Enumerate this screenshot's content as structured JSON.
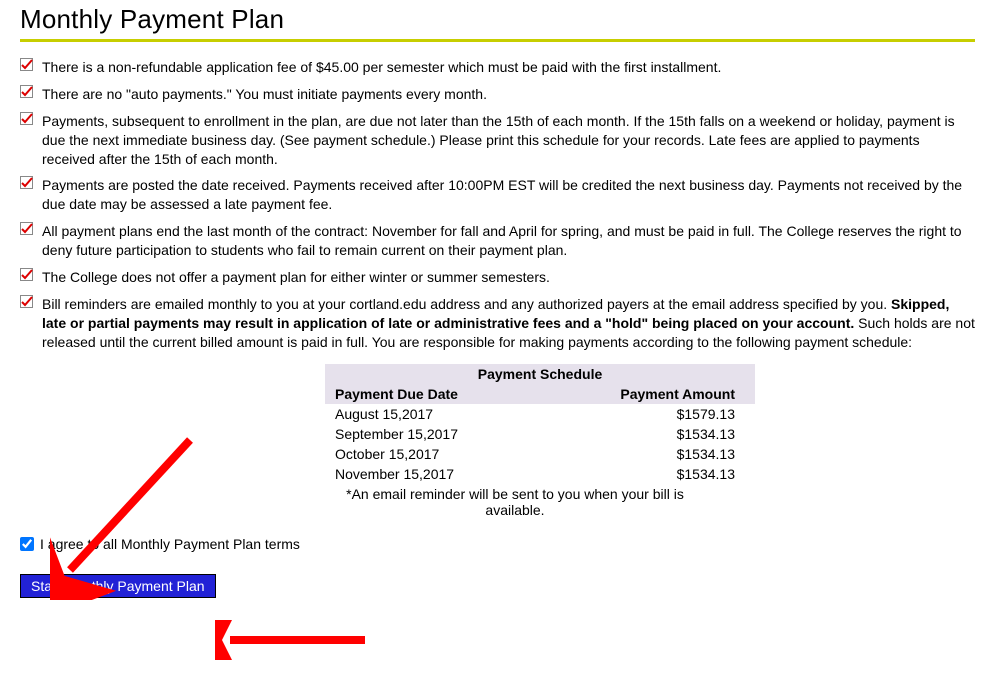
{
  "title": "Monthly Payment Plan",
  "terms": [
    {
      "text_parts": [
        {
          "text": "There is a non-refundable application fee of $45.00 per semester which must be paid with the first installment.",
          "bold": false
        }
      ]
    },
    {
      "text_parts": [
        {
          "text": "There are no \"auto payments.\" You must initiate payments every month.",
          "bold": false
        }
      ]
    },
    {
      "text_parts": [
        {
          "text": "Payments, subsequent to enrollment in the plan, are due not later than the 15th of each month. If the 15th falls on a weekend or holiday, payment is due the next immediate business day. (See payment schedule.) Please print this schedule for your records. Late fees are applied to payments received after the 15th of each month.",
          "bold": false
        }
      ]
    },
    {
      "text_parts": [
        {
          "text": "Payments are posted the date received. Payments received after 10:00PM EST will be credited the next business day. Payments not received by the due date may be assessed a late payment fee.",
          "bold": false
        }
      ]
    },
    {
      "text_parts": [
        {
          "text": "All payment plans end the last month of the contract: November for fall and April for spring, and must be paid in full. The College reserves the right to deny future participation to students who fail to remain current on their payment plan.",
          "bold": false
        }
      ]
    },
    {
      "text_parts": [
        {
          "text": "The College does not offer a payment plan for either winter or summer semesters.",
          "bold": false
        }
      ]
    },
    {
      "text_parts": [
        {
          "text": "Bill reminders are emailed monthly to you at your cortland.edu address and any authorized payers at the email address specified by you. ",
          "bold": false
        },
        {
          "text": "Skipped, late or partial payments may result in application of late or administrative fees and a \"hold\" being placed on your account.",
          "bold": true
        },
        {
          "text": " Such holds are not released until the current billed amount is paid in full. You are responsible for making payments according to the following payment schedule:",
          "bold": false
        }
      ]
    }
  ],
  "schedule": {
    "caption": "Payment Schedule",
    "headers": {
      "due": "Payment Due Date",
      "amount": "Payment Amount"
    },
    "rows": [
      {
        "due": "August 15,2017",
        "amount": "$1579.13"
      },
      {
        "due": "September 15,2017",
        "amount": "$1534.13"
      },
      {
        "due": "October 15,2017",
        "amount": "$1534.13"
      },
      {
        "due": "November 15,2017",
        "amount": "$1534.13"
      }
    ],
    "reminder": "*An email reminder will be sent to you when your bill is available."
  },
  "agree": {
    "label": "I agree to all Monthly Payment Plan terms",
    "checked": true
  },
  "start_button": "Start Monthly Payment Plan",
  "chart_data": {
    "type": "table",
    "title": "Payment Schedule",
    "columns": [
      "Payment Due Date",
      "Payment Amount"
    ],
    "rows": [
      [
        "August 15,2017",
        1579.13
      ],
      [
        "September 15,2017",
        1534.13
      ],
      [
        "October 15,2017",
        1534.13
      ],
      [
        "November 15,2017",
        1534.13
      ]
    ]
  }
}
